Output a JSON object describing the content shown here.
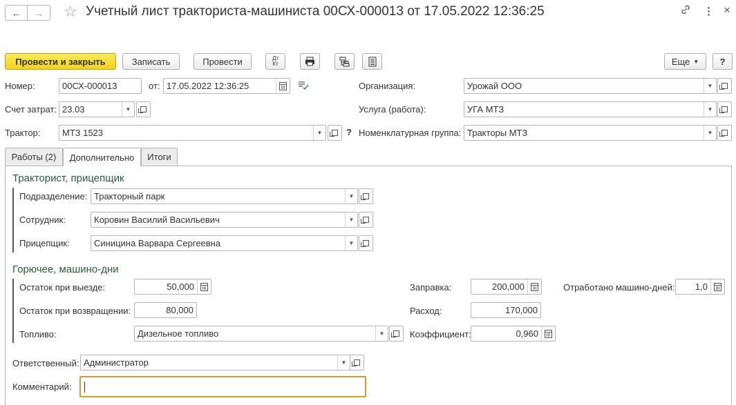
{
  "window": {
    "title": "Учетный лист тракториста-машиниста 00СХ-000013 от 17.05.2022 12:36:25",
    "nav_back": "←",
    "nav_forward": "→",
    "star": "☆",
    "link_icon": "link-icon",
    "more_icon": "⋮",
    "close_icon": "×"
  },
  "toolbar": {
    "post_and_close": "Провести и закрыть",
    "save": "Записать",
    "post": "Провести",
    "dt_kt": "Дт\nКт",
    "more": "Еще",
    "help": "?"
  },
  "header": {
    "number_label": "Номер:",
    "number_value": "00СХ-000013",
    "from_label": "от:",
    "date_value": "17.05.2022 12:36:25",
    "cost_account_label": "Счет затрат:",
    "cost_account_value": "23.03",
    "tractor_label": "Трактор:",
    "tractor_value": "МТЗ 1523",
    "question": "?",
    "organization_label": "Организация:",
    "organization_value": "Урожай ООО",
    "service_label": "Услуга (работа):",
    "service_value": "УГА МТЗ",
    "nomenclature_label": "Номенклатурная группа:",
    "nomenclature_value": "Тракторы МТЗ"
  },
  "tabs": [
    {
      "label": "Работы (2)",
      "active": false
    },
    {
      "label": "Дополнительно",
      "active": true
    },
    {
      "label": "Итоги",
      "active": false
    }
  ],
  "driver_section": {
    "title": "Тракторист, прицепщик",
    "department_label": "Подразделение:",
    "department_value": "Тракторный парк",
    "employee_label": "Сотрудник:",
    "employee_value": "Коровин Василий Васильевич",
    "trailer_label": "Прицепщик:",
    "trailer_value": "Синицина Варвара Сергеевна"
  },
  "fuel_section": {
    "title": "Горючее, машино-дни",
    "start_balance_label": "Остаток при выезде:",
    "start_balance_value": "50,000",
    "return_balance_label": "Остаток при возвращении:",
    "return_balance_value": "80,000",
    "fuel_label": "Топливо:",
    "fuel_value": "Дизельное топливо",
    "refuel_label": "Заправка:",
    "refuel_value": "200,000",
    "consumption_label": "Расход:",
    "consumption_value": "170,000",
    "coefficient_label": "Коэффициент:",
    "coefficient_value": "0,960",
    "machine_days_label": "Отработано машино-дней:",
    "machine_days_value": "1,0"
  },
  "footer": {
    "responsible_label": "Ответственный:",
    "responsible_value": "Администратор",
    "comment_label": "Комментарий:",
    "comment_value": ""
  },
  "colors": {
    "primary_button": "#f2d21d",
    "section_title": "#2e5b3a",
    "focus_border": "#c9a227"
  }
}
